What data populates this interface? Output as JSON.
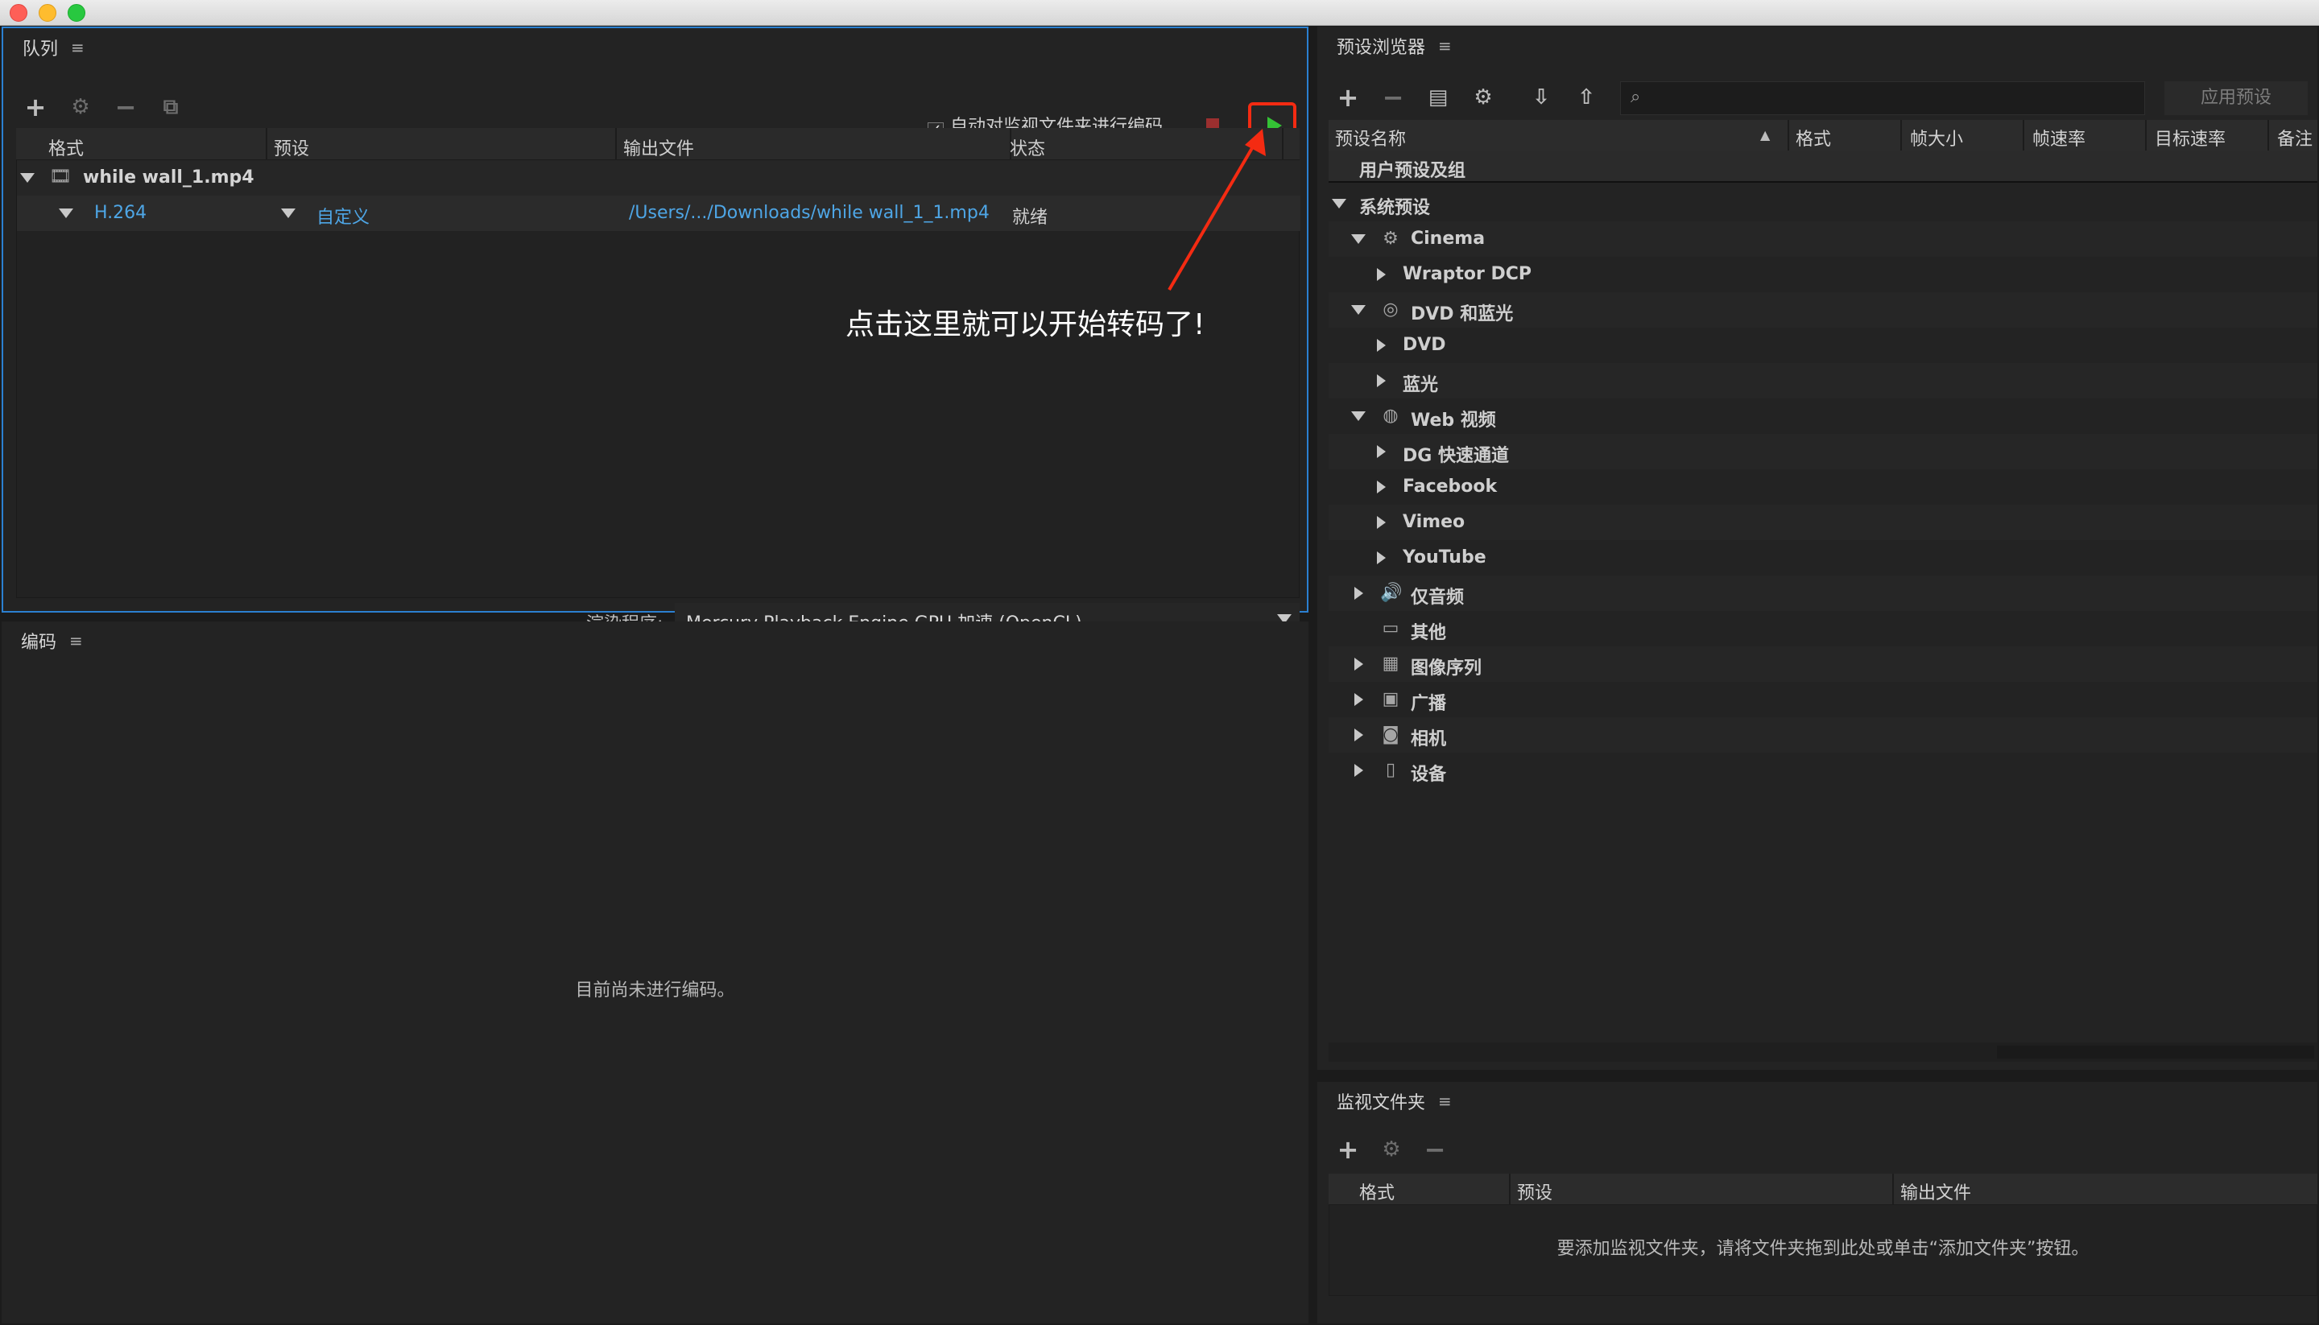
{
  "window": {
    "controls": {
      "close": "close-icon",
      "minimize": "minimize-icon",
      "zoom": "zoom-icon"
    }
  },
  "queue": {
    "title": "队列",
    "menu": "≡",
    "toolbar": {
      "add": "+",
      "settings": "⚙",
      "remove": "−",
      "duplicate": "⧉"
    },
    "auto_encode_checked": "✓",
    "auto_encode_label": "自动对监视文件夹进行编码",
    "columns": {
      "format": "格式",
      "preset": "预设",
      "output": "输出文件",
      "status": "状态"
    },
    "file": {
      "name": "while wall_1.mp4"
    },
    "item": {
      "format": "H.264",
      "preset": "自定义",
      "output": "/Users/.../Downloads/while wall_1_1.mp4",
      "status": "就绪"
    },
    "renderer_label": "渲染程序:",
    "renderer_value": "Mercury Playback Engine GPU 加速 (OpenCL)"
  },
  "annotation": {
    "text": "点击这里就可以开始转码了!",
    "color": "#f42b12"
  },
  "encoding": {
    "title": "编码",
    "menu": "≡",
    "empty": "目前尚未进行编码。"
  },
  "presets": {
    "title": "预设浏览器",
    "menu": "≡",
    "toolbar": {
      "add": "+",
      "remove": "−",
      "group": "▤",
      "settings": "⚙",
      "import": "⇩",
      "export": "⇧"
    },
    "search_icon": "⌕",
    "apply_label": "应用预设",
    "columns": {
      "name": "预设名称",
      "format": "格式",
      "frame_size": "帧大小",
      "frame_rate": "帧速率",
      "target_rate": "目标速率",
      "comment": "备注"
    },
    "rows": [
      {
        "label": "用户预设及组"
      },
      {
        "label": "系统预设"
      },
      {
        "label": "Cinema",
        "icon": "cinema-icon"
      },
      {
        "label": "Wraptor DCP"
      },
      {
        "label": "DVD 和蓝光",
        "icon": "disc-icon"
      },
      {
        "label": "DVD"
      },
      {
        "label": "蓝光"
      },
      {
        "label": "Web 视频",
        "icon": "globe-icon"
      },
      {
        "label": "DG 快速通道"
      },
      {
        "label": "Facebook"
      },
      {
        "label": "Vimeo"
      },
      {
        "label": "YouTube"
      },
      {
        "label": "仅音频",
        "icon": "speaker-icon"
      },
      {
        "label": "其他",
        "icon": "monitor-icon"
      },
      {
        "label": "图像序列",
        "icon": "film-icon"
      },
      {
        "label": "广播",
        "icon": "tv-icon"
      },
      {
        "label": "相机",
        "icon": "camera-icon"
      },
      {
        "label": "设备",
        "icon": "phone-icon"
      }
    ]
  },
  "watch": {
    "title": "监视文件夹",
    "menu": "≡",
    "toolbar": {
      "add": "+",
      "settings": "⚙",
      "remove": "−"
    },
    "columns": {
      "format": "格式",
      "preset": "预设",
      "output": "输出文件"
    },
    "empty": "要添加监视文件夹，请将文件夹拖到此处或单击“添加文件夹”按钮。"
  }
}
